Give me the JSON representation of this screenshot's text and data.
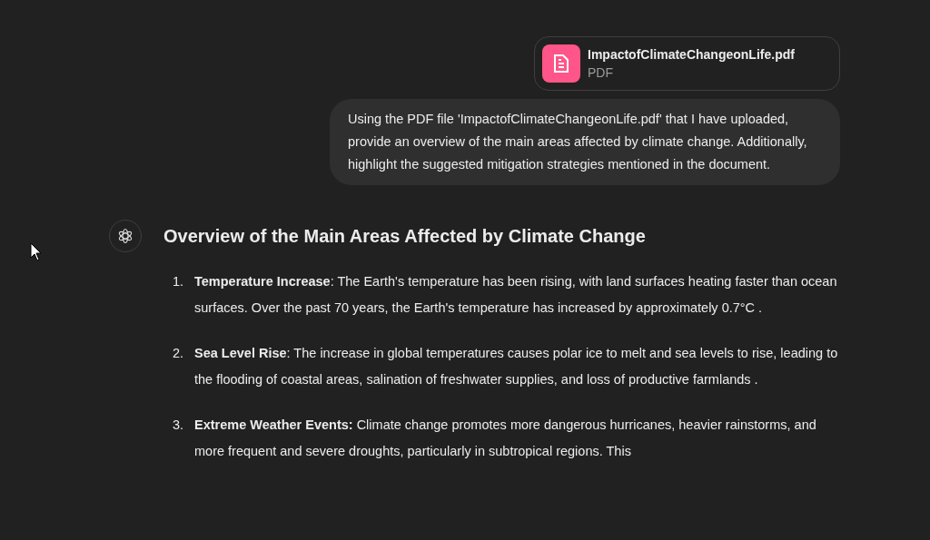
{
  "attachment": {
    "name": "ImpactofClimateChangeonLife.pdf",
    "type": "PDF"
  },
  "user_message": "Using the PDF file 'ImpactofClimateChangeonLife.pdf' that I have uploaded, provide an overview of the main areas affected by climate change. Additionally, highlight the suggested mitigation strategies mentioned in the document.",
  "response": {
    "heading": "Overview of the Main Areas Affected by Climate Change",
    "items": [
      {
        "number": "1.",
        "text": "**Temperature Increase**: The Earth's temperature has been rising, with land surfaces heating faster than ocean surfaces. Over the past 70 years, the Earth's temperature has increased by approximately 0.7°C ."
      },
      {
        "number": "2.",
        "text": "**Sea Level Rise**: The increase in global temperatures causes polar ice to melt and sea levels to rise, leading to the flooding of coastal areas, salination of freshwater supplies, and loss of productive farmlands ."
      },
      {
        "number": "3.",
        "text": "**Extreme Weather Events:** Climate change promotes more dangerous hurricanes, heavier rainstorms, and more frequent and severe droughts, particularly in subtropical regions. This"
      }
    ]
  }
}
